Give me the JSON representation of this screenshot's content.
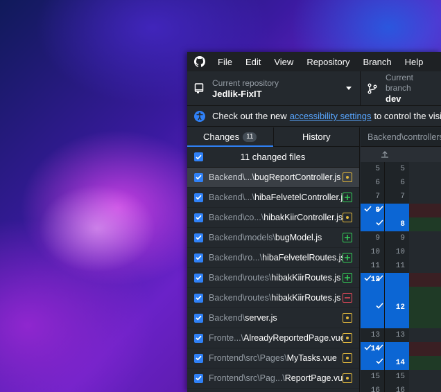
{
  "menubar": {
    "items": [
      "File",
      "Edit",
      "View",
      "Repository",
      "Branch",
      "Help"
    ]
  },
  "toolbar": {
    "repo_label": "Current repository",
    "repo_value": "Jedlik-FixIT",
    "branch_label": "Current branch",
    "branch_value": "dev"
  },
  "banner": {
    "text_before": "Check out the new",
    "link_text": "accessibility settings",
    "text_after": "to control the visibility"
  },
  "tabs": {
    "changes_label": "Changes",
    "changes_count": "11",
    "history_label": "History"
  },
  "changes": {
    "header": "11 changed files",
    "files": [
      {
        "dir": "Backend\\...\\",
        "name": "bugReportController.js",
        "status": "modified"
      },
      {
        "dir": "Backend\\...\\",
        "name": "hibaFelvetelController.js",
        "status": "added"
      },
      {
        "dir": "Backend\\co...\\",
        "name": "hibakKiirController.js",
        "status": "modified"
      },
      {
        "dir": "Backend\\models\\",
        "name": "bugModel.js",
        "status": "added"
      },
      {
        "dir": "Backend\\ro...\\",
        "name": "hibaFelvetelRoutes.js",
        "status": "added"
      },
      {
        "dir": "Backend\\routes\\",
        "name": "hibakKiirRoutes.js",
        "status": "added"
      },
      {
        "dir": "Backend\\routes\\",
        "name": "hibakKiirRoutes.js",
        "status": "deleted"
      },
      {
        "dir": "Backend\\",
        "name": "server.js",
        "status": "modified"
      },
      {
        "dir": "Fronte...\\",
        "name": "AlreadyReportedPage.vue",
        "status": "modified"
      },
      {
        "dir": "Frontend\\src\\Pages\\",
        "name": "MyTasks.vue",
        "status": "modified"
      },
      {
        "dir": "Frontend\\src\\Pag...\\",
        "name": "ReportPage.vue",
        "status": "modified"
      }
    ]
  },
  "diff": {
    "path": "Backend\\controllers",
    "lines": [
      {
        "old": "5",
        "new": "5"
      },
      {
        "old": "6",
        "new": "6"
      },
      {
        "old": "7",
        "new": "7"
      },
      {
        "old": "8",
        "new": ""
      },
      {
        "old": "",
        "new": "8"
      },
      {
        "old": "9",
        "new": "9"
      },
      {
        "old": "10",
        "new": "10"
      },
      {
        "old": "11",
        "new": "11"
      },
      {
        "old": "12",
        "new": ""
      },
      {
        "old": "",
        "new": ""
      },
      {
        "old": "",
        "new": "12"
      },
      {
        "old": "",
        "new": ""
      },
      {
        "old": "13",
        "new": "13"
      },
      {
        "old": "14",
        "new": ""
      },
      {
        "old": "",
        "new": "14"
      },
      {
        "old": "15",
        "new": "15"
      },
      {
        "old": "16",
        "new": "16"
      }
    ]
  }
}
